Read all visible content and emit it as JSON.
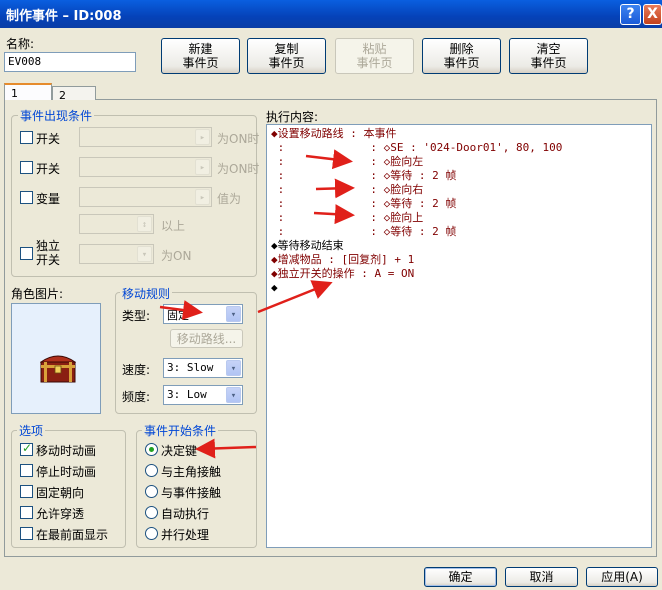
{
  "window": {
    "title": "制作事件 – ID:008",
    "help_label": "?",
    "close_label": "X"
  },
  "name_field": {
    "label": "名称:",
    "value": "EV008"
  },
  "toolbar": {
    "new_page": [
      "新建",
      "事件页"
    ],
    "copy_page": [
      "复制",
      "事件页"
    ],
    "paste_page": [
      "粘贴",
      "事件页"
    ],
    "delete_page": [
      "删除",
      "事件页"
    ],
    "clear_page": [
      "清空",
      "事件页"
    ]
  },
  "tabs": [
    "1",
    "2"
  ],
  "conditions": {
    "title": "事件出现条件",
    "switch1_label": "开关",
    "switch1_suffix": "为ON时",
    "switch2_label": "开关",
    "switch2_suffix": "为ON时",
    "variable_label": "变量",
    "variable_suffix": "值为",
    "above_label": "以上",
    "self_switch_label": [
      "独立",
      "开关"
    ],
    "self_switch_suffix": "为ON"
  },
  "graphic": {
    "label": "角色图片:",
    "icon": "treasure-chest"
  },
  "movement": {
    "title": "移动规则",
    "type_label": "类型:",
    "type_value": "固定",
    "route_button": "移动路线...",
    "speed_label": "速度:",
    "speed_value": "3: Slow",
    "freq_label": "频度:",
    "freq_value": "3: Low"
  },
  "options": {
    "title": "选项",
    "items": [
      {
        "label": "移动时动画",
        "checked": true
      },
      {
        "label": "停止时动画",
        "checked": false
      },
      {
        "label": "固定朝向",
        "checked": false
      },
      {
        "label": "允许穿透",
        "checked": false
      },
      {
        "label": "在最前面显示",
        "checked": false
      }
    ]
  },
  "trigger": {
    "title": "事件开始条件",
    "items": [
      {
        "label": "决定键",
        "checked": true
      },
      {
        "label": "与主角接触",
        "checked": false
      },
      {
        "label": "与事件接触",
        "checked": false
      },
      {
        "label": "自动执行",
        "checked": false
      },
      {
        "label": "并行处理",
        "checked": false
      }
    ]
  },
  "contents": {
    "label": "执行内容:",
    "lines": [
      {
        "text": "◆设置移动路线 : 本事件",
        "color": "#800000"
      },
      {
        "text": " :             : ◇SE : '024-Door01', 80, 100",
        "color": "#800000"
      },
      {
        "text": " :             : ◇脸向左",
        "color": "#800000"
      },
      {
        "text": " :             : ◇等待 : 2 帧",
        "color": "#800000"
      },
      {
        "text": " :             : ◇脸向右",
        "color": "#800000"
      },
      {
        "text": " :             : ◇等待 : 2 帧",
        "color": "#800000"
      },
      {
        "text": " :             : ◇脸向上",
        "color": "#800000"
      },
      {
        "text": " :             : ◇等待 : 2 帧",
        "color": "#800000"
      },
      {
        "text": "◆等待移动结束",
        "color": "#000000"
      },
      {
        "text": "◆增减物品 : [回复剂] + 1",
        "color": "#800000"
      },
      {
        "text": "◆独立开关的操作 : A = ON",
        "color": "#800000"
      },
      {
        "text": "◆",
        "color": "#000000"
      }
    ]
  },
  "footer": {
    "ok": "确定",
    "cancel": "取消",
    "apply": "应用(A)"
  },
  "colors": {
    "accent": "#0046d5",
    "annotation_arrow": "#e0201a"
  }
}
